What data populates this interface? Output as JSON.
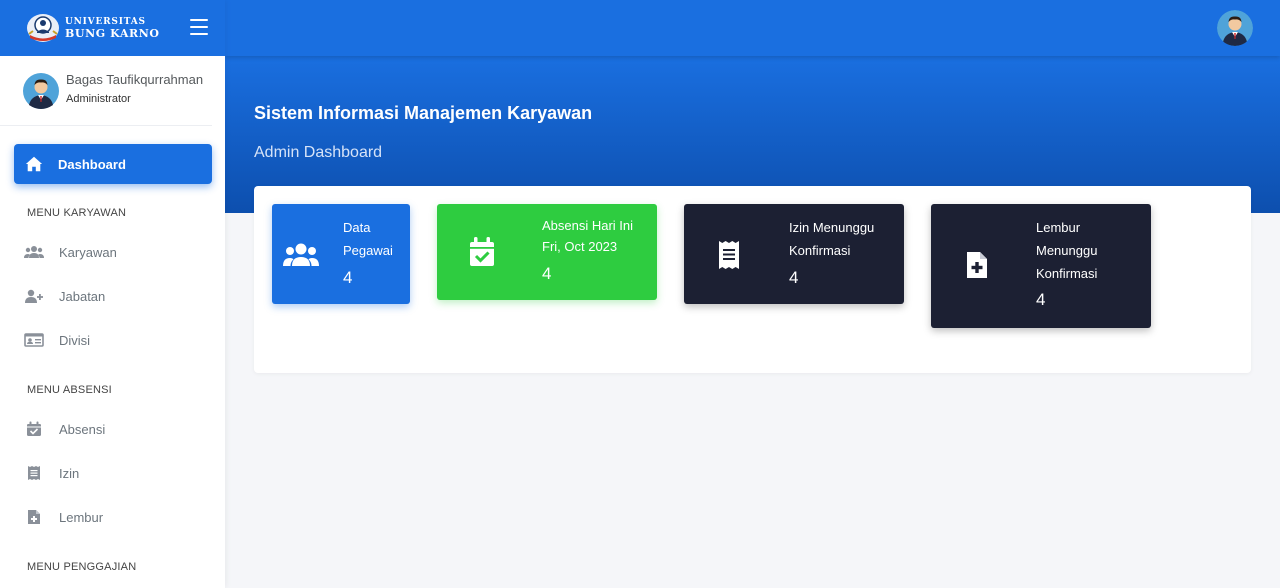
{
  "brand": {
    "line1": "UNIVERSITAS",
    "line2": "BUNG KARNO"
  },
  "user": {
    "name": "Bagas Taufikqurrahman",
    "role": "Administrator"
  },
  "sidebar": {
    "active": {
      "label": "Dashboard",
      "icon": "home-icon"
    },
    "sections": [
      {
        "header": "MENU KARYAWAN",
        "items": [
          {
            "label": "Karyawan",
            "icon": "users-icon"
          },
          {
            "label": "Jabatan",
            "icon": "user-plus-icon"
          },
          {
            "label": "Divisi",
            "icon": "id-card-icon"
          }
        ]
      },
      {
        "header": "MENU ABSENSI",
        "items": [
          {
            "label": "Absensi",
            "icon": "calendar-check-icon"
          },
          {
            "label": "Izin",
            "icon": "receipt-icon"
          },
          {
            "label": "Lembur",
            "icon": "file-medical-icon"
          }
        ]
      },
      {
        "header": "MENU PENGGAJIAN",
        "items": []
      }
    ]
  },
  "hero": {
    "title": "Sistem Informasi Manajemen Karyawan",
    "subtitle": "Admin Dashboard"
  },
  "stats": [
    {
      "label_line1": "Data",
      "label_line2": "Pegawai",
      "value": "4",
      "icon": "users-icon",
      "color": "#1a6fe0"
    },
    {
      "label_line1": "Absensi Hari Ini",
      "label_line2": "Fri, Oct 2023",
      "value": "4",
      "icon": "calendar-check-icon",
      "color": "#2ecc40"
    },
    {
      "label_line1": "Izin Menunggu",
      "label_line2": "Konfirmasi",
      "value": "4",
      "icon": "receipt-icon",
      "color": "#1c2033"
    },
    {
      "label_line1": "Lembur",
      "label_line2": "Menunggu",
      "label_line3": "Konfirmasi",
      "value": "4",
      "icon": "file-medical-icon",
      "color": "#1c2033"
    }
  ],
  "colors": {
    "primary": "#1a6fe0",
    "success": "#2ecc40",
    "dark": "#1c2033"
  }
}
